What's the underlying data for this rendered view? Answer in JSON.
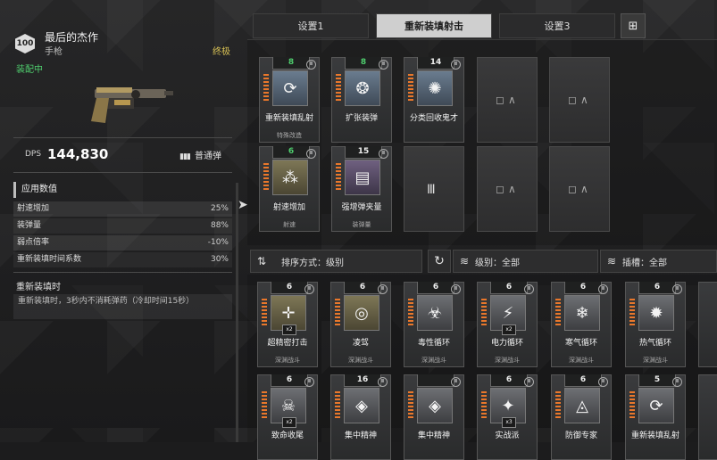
{
  "weapon": {
    "level": "100",
    "name": "最后的杰作",
    "type": "手枪",
    "rarity": "终极",
    "status": "装配中",
    "dps_label": "DPS",
    "dps_value": "144,830",
    "ammo_icon": "ammo-icon",
    "ammo_type": "普通弹"
  },
  "stats_section": {
    "title": "应用数值",
    "rows": [
      {
        "label": "射速增加",
        "value": "25%"
      },
      {
        "label": "装弹量",
        "value": "88%"
      },
      {
        "label": "弱点倍率",
        "value": "-10%"
      },
      {
        "label": "重新装填时间系数",
        "value": "30%"
      }
    ]
  },
  "reload": {
    "title": "重新装填时",
    "desc": "重新装填时，3秒内不消耗弹药（冷却时间15秒）"
  },
  "tabs": [
    {
      "label": "设置1"
    },
    {
      "label": "重新装填射击",
      "active": true
    },
    {
      "label": "设置3"
    }
  ],
  "equipped_mods": [
    {
      "cost": "8",
      "name": "重新装填乱射",
      "sub": "特殊改造",
      "cost_color": "#4fce6e"
    },
    {
      "cost": "8",
      "name": "扩张装弹",
      "sub": "",
      "cost_color": "#4fce6e"
    },
    {
      "cost": "14",
      "name": "分类回收鬼才",
      "sub": "",
      "cost_color": "#eeeeee"
    },
    {
      "cost": "6",
      "name": "射速增加",
      "sub": "射速",
      "cost_color": "#4fce6e"
    },
    {
      "cost": "15",
      "name": "强增弹夹量",
      "sub": "装弹量",
      "cost_color": "#eeeeee"
    }
  ],
  "filters": {
    "sort": "排序方式：级别",
    "level": "级别：全部",
    "slot": "插槽：全部"
  },
  "inventory_row1": [
    {
      "cost": "6",
      "name": "超精密打击",
      "sub": "深渊战斗",
      "x2": "x2"
    },
    {
      "cost": "6",
      "name": "凌驾",
      "sub": "深渊战斗",
      "x2": ""
    },
    {
      "cost": "6",
      "name": "毒性循环",
      "sub": "深渊战斗",
      "x2": ""
    },
    {
      "cost": "6",
      "name": "电力循环",
      "sub": "深渊战斗",
      "x2": "x2"
    },
    {
      "cost": "6",
      "name": "寒气循环",
      "sub": "深渊战斗",
      "x2": ""
    },
    {
      "cost": "6",
      "name": "热气循环",
      "sub": "深渊战斗",
      "x2": ""
    }
  ],
  "inventory_row2": [
    {
      "cost": "6",
      "name": "致命收尾",
      "x2": "x2"
    },
    {
      "cost": "16",
      "name": "集中精神",
      "x2": ""
    },
    {
      "cost": "",
      "name": "集中精神",
      "x2": ""
    },
    {
      "cost": "6",
      "name": "实战派",
      "x2": "x3"
    },
    {
      "cost": "6",
      "name": "防御专家",
      "x2": ""
    },
    {
      "cost": "5",
      "name": "重新装填乱射",
      "x2": ""
    }
  ]
}
